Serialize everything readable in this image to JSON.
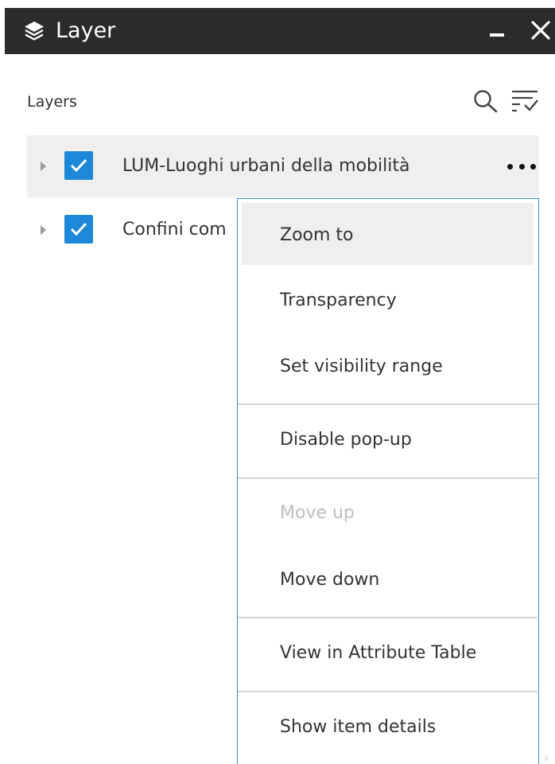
{
  "window": {
    "title": "Layer",
    "icon": "layers-icon"
  },
  "toolbar": {
    "label": "Layers",
    "search_icon": "search-icon",
    "filter_icon": "filter-icon"
  },
  "layers": [
    {
      "label": "LUM-Luoghi urbani della mobilità",
      "checked": true,
      "selected": true
    },
    {
      "label": "Confini com",
      "checked": true,
      "selected": false
    }
  ],
  "context_menu": {
    "items": [
      {
        "label": "Zoom to",
        "state": "hover"
      },
      {
        "label": "Transparency",
        "state": "normal"
      },
      {
        "label": "Set visibility range",
        "state": "normal"
      },
      {
        "label": "Disable pop-up",
        "state": "normal"
      },
      {
        "label": "Move up",
        "state": "disabled"
      },
      {
        "label": "Move down",
        "state": "normal"
      },
      {
        "label": "View in Attribute Table",
        "state": "normal"
      },
      {
        "label": "Show item details",
        "state": "normal"
      }
    ]
  },
  "colors": {
    "titlebar": "#2b2b2b",
    "checkbox": "#1e88d8",
    "menu_border": "#3b8fdb",
    "row_highlight": "#efefef"
  }
}
